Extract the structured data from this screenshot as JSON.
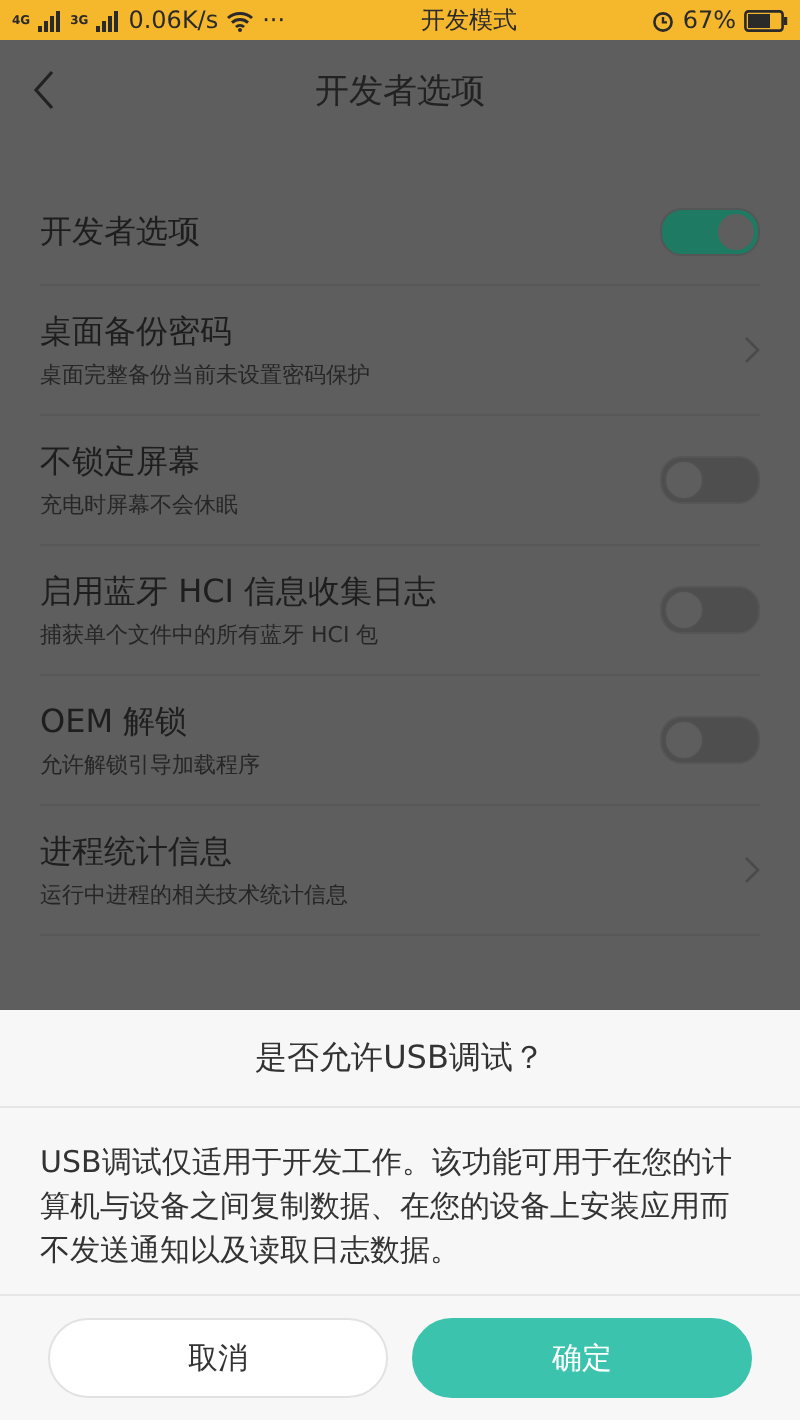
{
  "status_bar": {
    "networks": [
      "4G",
      "3G"
    ],
    "speed": "0.06K/s",
    "more": "···",
    "center": "开发模式",
    "battery": "67%"
  },
  "header": {
    "title": "开发者选项"
  },
  "settings": [
    {
      "kind": "toggle",
      "title": "开发者选项",
      "on": true
    },
    {
      "kind": "link",
      "title": "桌面备份密码",
      "subtitle": "桌面完整备份当前未设置密码保护"
    },
    {
      "kind": "toggle",
      "title": "不锁定屏幕",
      "subtitle": "充电时屏幕不会休眠",
      "on": false
    },
    {
      "kind": "toggle",
      "title": "启用蓝牙 HCI 信息收集日志",
      "subtitle": "捕获单个文件中的所有蓝牙 HCI 包",
      "on": false
    },
    {
      "kind": "toggle",
      "title": "OEM 解锁",
      "subtitle": "允许解锁引导加载程序",
      "on": false
    },
    {
      "kind": "link",
      "title": "进程统计信息",
      "subtitle": "运行中进程的相关技术统计信息"
    }
  ],
  "dialog": {
    "title": "是否允许USB调试？",
    "message": "USB调试仅适用于开发工作。该功能可用于在您的计算机与设备之间复制数据、在您的设备上安装应用而不发送通知以及读取日志数据。",
    "buttons": [
      {
        "label": "取消",
        "kind": "secondary"
      },
      {
        "label": "确定",
        "kind": "primary"
      }
    ]
  }
}
